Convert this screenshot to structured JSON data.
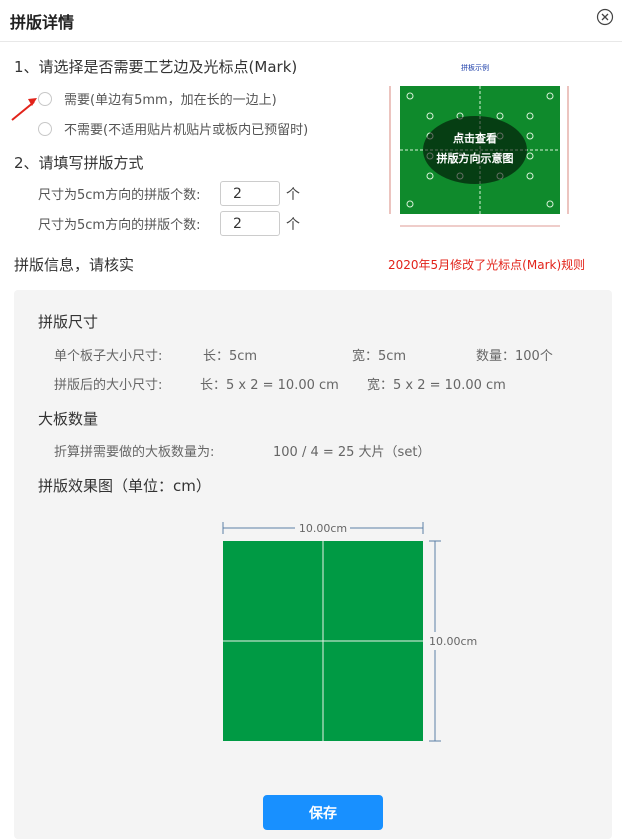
{
  "dialog": {
    "title": "拼版详情",
    "close_icon": "close-circle-icon"
  },
  "mark": {
    "question": "1、请选择是否需要工艺边及光标点(Mark)",
    "options": [
      {
        "label": "需要(单边有5mm，加在长的一边上)",
        "selected": false
      },
      {
        "label": "不需要(不适用贴片机贴片或板内已预留时)",
        "selected": false
      }
    ]
  },
  "method": {
    "question": "2、请填写拼版方式",
    "rows": [
      {
        "label": "尺寸为5cm方向的拼版个数:",
        "value": "2",
        "unit": "个"
      },
      {
        "label": "尺寸为5cm方向的拼版个数:",
        "value": "2",
        "unit": "个"
      }
    ]
  },
  "sample": {
    "title": "拼板示例",
    "overlay_line1": "点击查看",
    "overlay_line2": "拼版方向示意图",
    "caption": "2020年5月修改了光标点(Mark)规则",
    "board_color": "#0f8a2c"
  },
  "info": {
    "heading": "拼版信息，请核实",
    "size": {
      "title": "拼版尺寸",
      "single_label": "单个板子大小尺寸:",
      "single_length": "长：5cm",
      "single_width": "宽：5cm",
      "quantity": "数量：100个",
      "after_label": "拼版后的大小尺寸:",
      "after_length": "长：5 x 2 = 10.00 cm",
      "after_width": "宽：5 x 2 = 10.00 cm"
    },
    "boards": {
      "title": "大板数量",
      "label": "折算拼需要做的大板数量为:",
      "value": "100 / 4 = 25 大片（set）"
    },
    "effect": {
      "title": "拼版效果图（单位：cm）",
      "width_label": "10.00cm",
      "height_label": "10.00cm",
      "panel_color": "#009a44",
      "columns": 2,
      "rows": 2
    }
  },
  "actions": {
    "save_label": "保存",
    "save_color": "#1890ff"
  }
}
